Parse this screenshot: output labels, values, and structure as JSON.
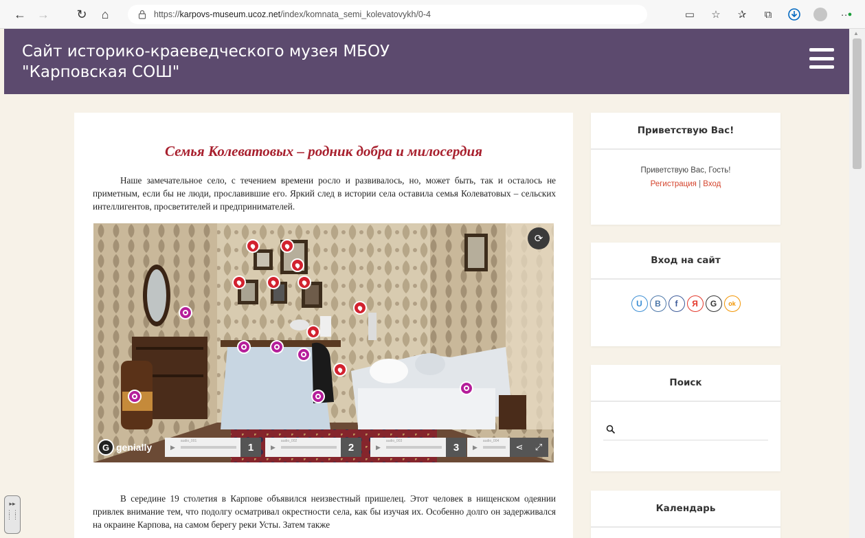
{
  "browser": {
    "url_prefix": "https://",
    "url_host": "karpovs-museum.ucoz.net",
    "url_path": "/index/komnata_semi_kolevatovykh/0-4"
  },
  "site": {
    "title_line1": "Сайт историко-краеведческого музея МБОУ",
    "title_line2": "\"Карповская СОШ\""
  },
  "article": {
    "title": "Семья Колеватовых – родник добра и милосердия",
    "paragraph1": "Наше замечательное село, с течением времени росло и развивалось, но, может быть, так  и осталось не приметным, если бы  не люди, прославившие его. Яркий след в истории села оставила семья Колеватовых – сельских интеллигентов, просветителей и предпринимателей.",
    "paragraph2": "В середине 19  столетия в Карпове объявился неизвестный пришелец. Этот человек в нищенском одеянии привлек внимание тем, что подолгу осматривал окрестности села, как бы изучая их.  Особенно долго он задерживался на окраине Карпова, на самом берегу реки Усты. Затем также"
  },
  "genially": {
    "logo_text": "genially",
    "audio": [
      {
        "num": "1",
        "file": "audio_001"
      },
      {
        "num": "2",
        "file": "audio_002"
      },
      {
        "num": "3",
        "file": "audio_003"
      },
      {
        "num": "",
        "file": "audio_004"
      }
    ]
  },
  "sidebar": {
    "welcome": {
      "title": "Приветствую Вас!",
      "greeting": "Приветствую Вас, Гость!",
      "register": "Регистрация",
      "separator": " | ",
      "login": "Вход"
    },
    "login": {
      "title": "Вход на сайт",
      "providers": [
        {
          "name": "uid",
          "glyph": "U",
          "color": "#3b8ed4"
        },
        {
          "name": "vk",
          "glyph": "В",
          "color": "#4a76a8"
        },
        {
          "name": "facebook",
          "glyph": "f",
          "color": "#3b5998"
        },
        {
          "name": "yandex",
          "glyph": "Я",
          "color": "#e3372a"
        },
        {
          "name": "google",
          "glyph": "G",
          "color": "#333333"
        },
        {
          "name": "odnoklassniki",
          "glyph": "ok",
          "color": "#f29400"
        }
      ]
    },
    "search": {
      "title": "Поиск",
      "placeholder": ""
    },
    "calendar": {
      "title": "Календарь"
    }
  },
  "colors": {
    "header_bg": "#5c4a6e",
    "page_bg": "#f7f2e8",
    "title_red": "#a8202e",
    "link_orange": "#d4432c"
  }
}
